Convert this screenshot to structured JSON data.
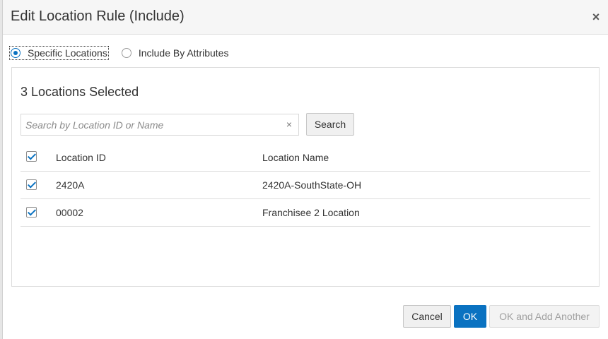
{
  "dialog": {
    "title": "Edit Location Rule (Include)",
    "close_glyph": "×"
  },
  "mode": {
    "options": [
      {
        "label": "Specific Locations",
        "selected": true
      },
      {
        "label": "Include By Attributes",
        "selected": false
      }
    ]
  },
  "selection": {
    "count_text": "3 Locations Selected"
  },
  "search": {
    "placeholder": "Search by Location ID or Name",
    "value": "",
    "clear_glyph": "×",
    "button_label": "Search"
  },
  "table": {
    "columns": [
      "Location ID",
      "Location Name"
    ],
    "header_checked": true,
    "rows": [
      {
        "id": "2420A",
        "name": "2420A-SouthState-OH",
        "checked": true
      },
      {
        "id": "00002",
        "name": "Franchisee 2 Location",
        "checked": true
      }
    ]
  },
  "footer": {
    "cancel_label": "Cancel",
    "ok_label": "OK",
    "ok_add_label": "OK and Add Another"
  },
  "colors": {
    "accent": "#0a72c1",
    "header_bg": "#f6f6f6",
    "disabled_text": "#a0a0a0"
  },
  "icons": {
    "close": "close-icon",
    "clear": "clear-icon",
    "checkbox_checked": "checkmark-icon"
  }
}
